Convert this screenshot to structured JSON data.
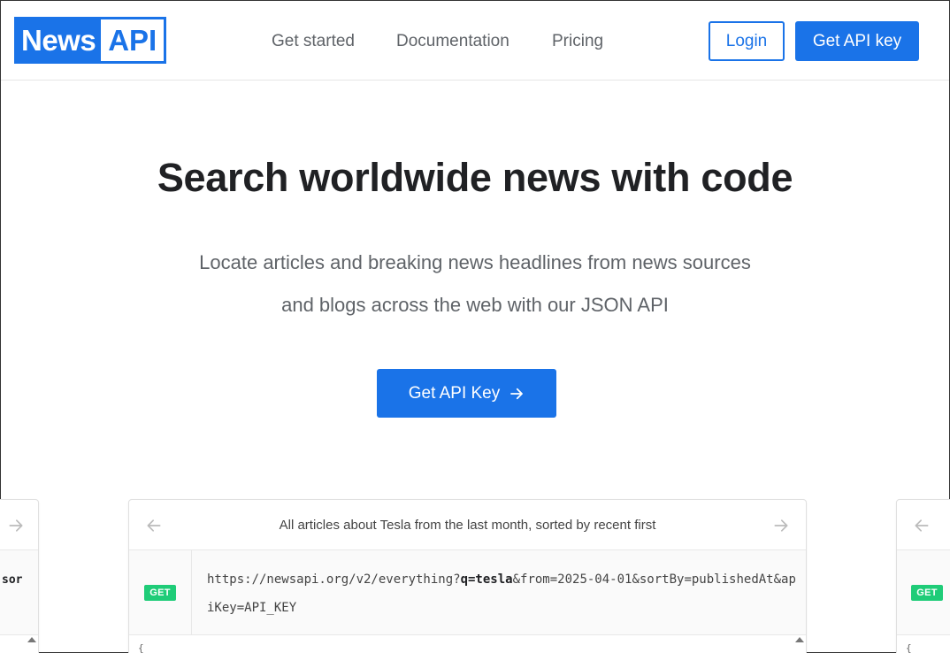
{
  "header": {
    "logo_news": "News",
    "logo_api": "API",
    "nav": [
      "Get started",
      "Documentation",
      "Pricing"
    ],
    "login_label": "Login",
    "get_key_label": "Get API key"
  },
  "hero": {
    "title": "Search worldwide news with code",
    "subtitle": "Locate articles and breaking news headlines from news sources and blogs across the web with our JSON API",
    "cta_label": "Get API Key",
    "cta_icon": "arrow-right-icon"
  },
  "example": {
    "caption": "All articles about Tesla from the last month, sorted by recent first",
    "method": "GET",
    "url_prefix": "https://newsapi.org/v2/everything?",
    "url_query_bold": "q=tesla",
    "url_rest": "&from=2025-04-01&sortBy=publishedAt&apiKey=API_KEY",
    "response_start": "{"
  },
  "side_cards": {
    "left_fragment": "sor",
    "method": "GET",
    "response_start": "{"
  },
  "colors": {
    "brand": "#1a73e8",
    "badge": "#1fcc78"
  }
}
